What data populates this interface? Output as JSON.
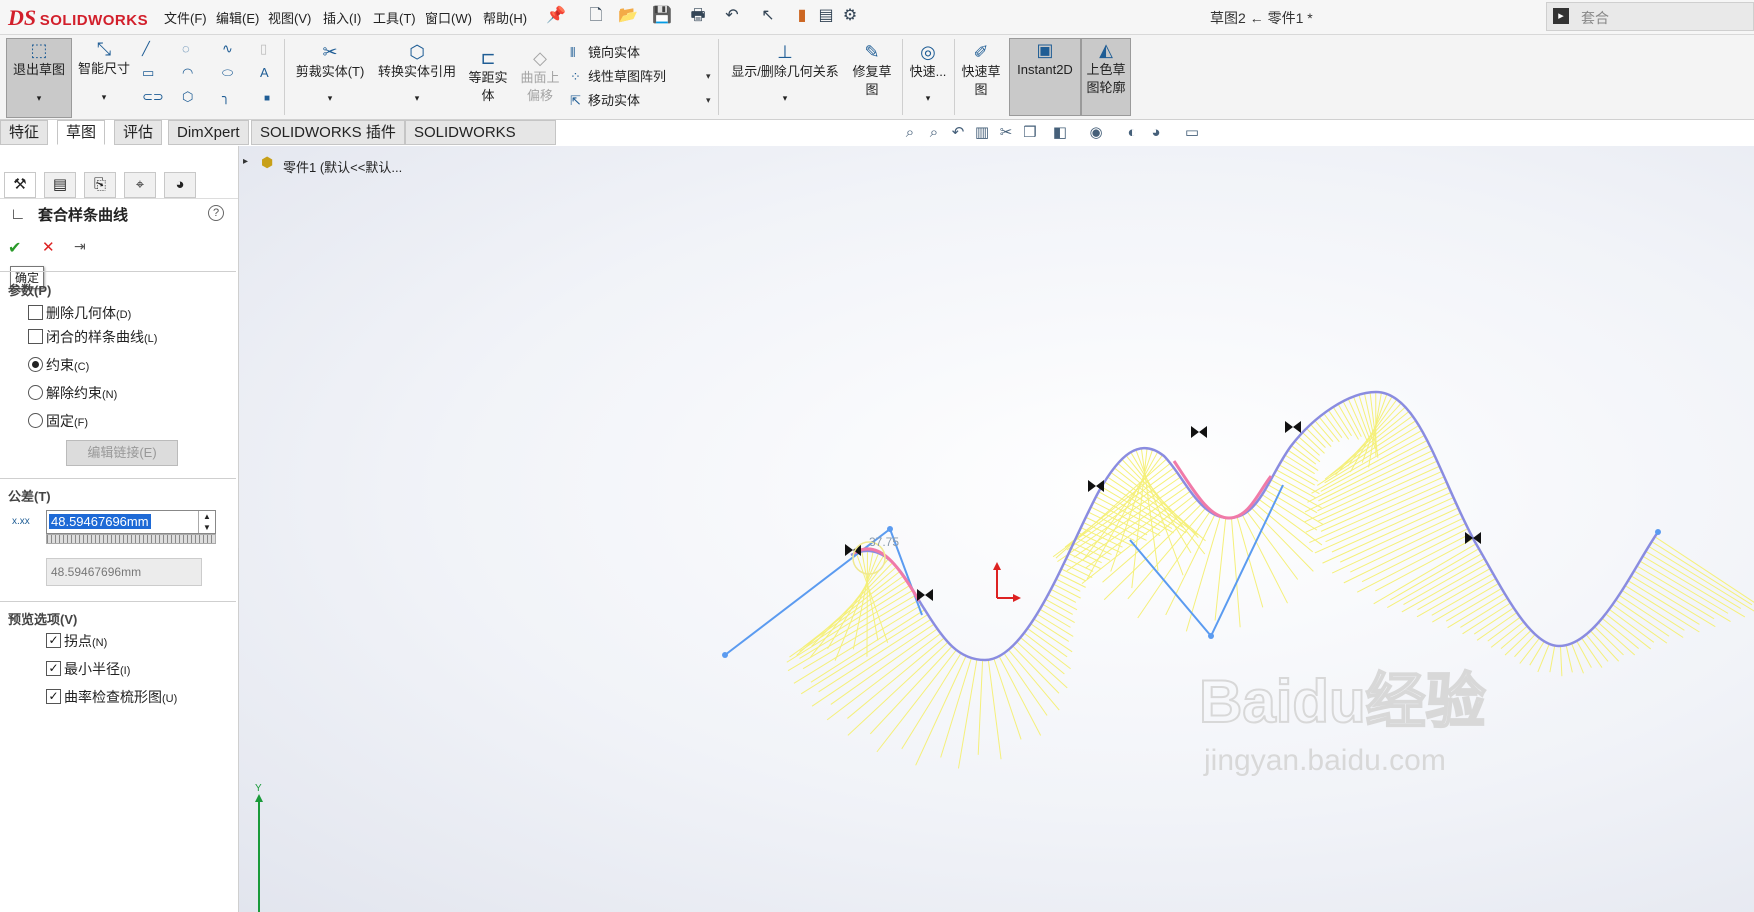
{
  "app": {
    "brand_ds": "DS",
    "brand_name": "SOLIDWORKS",
    "doc_title": "草图2 ← 零件1 *"
  },
  "menu": [
    "文件(F)",
    "编辑(E)",
    "视图(V)",
    "插入(I)",
    "工具(T)",
    "窗口(W)",
    "帮助(H)"
  ],
  "search": {
    "value": "套合"
  },
  "ribbon": {
    "exit_sketch": "退出草图",
    "smart_dim": "智能尺寸",
    "trim": "剪裁实体(T)",
    "convert": "转换实体引用",
    "offset": "等距实体",
    "surface_offset": "曲面上偏移",
    "mirror": "镜向实体",
    "linear_pattern": "线性草图阵列",
    "move": "移动实体",
    "relations": "显示/删除几何关系",
    "repair": "修复草图",
    "quick_snap": "快速...",
    "quick_sketch": "快速草图",
    "instant2d": "Instant2D",
    "shaded_contours": "上色草图轮廓"
  },
  "tabs": [
    "特征",
    "草图",
    "评估",
    "DimXpert",
    "SOLIDWORKS 插件",
    "SOLIDWORKS MBD"
  ],
  "tree": {
    "item": "零件1  (默认<<默认..."
  },
  "propertymanager": {
    "title": "套合样条曲线",
    "tooltip": "确定",
    "params_header": "参数(P)",
    "delete_geometry": "删除几何体",
    "delete_geometry_key": "(D)",
    "closed_spline": "闭合的样条曲线",
    "closed_spline_key": "(L)",
    "constrained": "约束",
    "constrained_key": "(C)",
    "unconstrained": "解除约束",
    "unconstrained_key": "(N)",
    "fixed": "固定",
    "fixed_key": "(F)",
    "edit_link": "编辑链接(E)",
    "tolerance_header": "公差(T)",
    "tolerance_value": "48.59467696mm",
    "tolerance_readonly": "48.59467696mm",
    "preview_header": "预览选项(V)",
    "inflection": "拐点",
    "inflection_key": "(N)",
    "min_radius": "最小半径",
    "min_radius_key": "(I)",
    "curvature_comb": "曲率检查梳形图",
    "curvature_comb_key": "(U)"
  },
  "canvas": {
    "dimension": "37.75",
    "triad_y": "Y"
  },
  "watermark": {
    "brand": "Baidu经验",
    "url": "jingyan.baidu.com"
  },
  "colors": {
    "spline": "#8a8ce0",
    "sketch_line": "#5b9bf0",
    "comb": "#f5f07a",
    "highlight": "#f07aa8",
    "accent_red": "#d21f2b"
  }
}
